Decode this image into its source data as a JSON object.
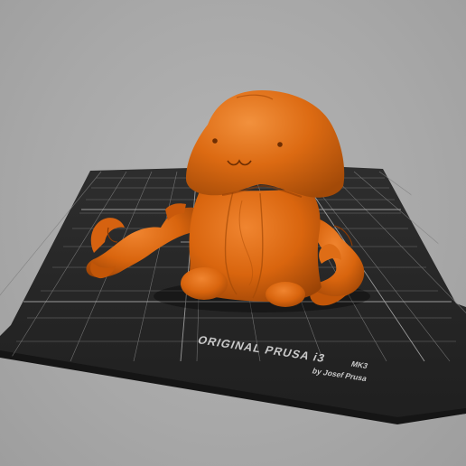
{
  "viewport": {
    "name": "3D print bed view",
    "background_color": "#a9a9a9"
  },
  "print_bed": {
    "brand_line": "ORIGINAL PRUSA i3",
    "model_suffix": "MK3",
    "byline": "by Josef Prusa",
    "sheet_color": "#262626",
    "grid_color": "#8c8c8c"
  },
  "model": {
    "name": "creature figurine",
    "color": "#d9650e",
    "shadow_color": "#8a3a05"
  }
}
